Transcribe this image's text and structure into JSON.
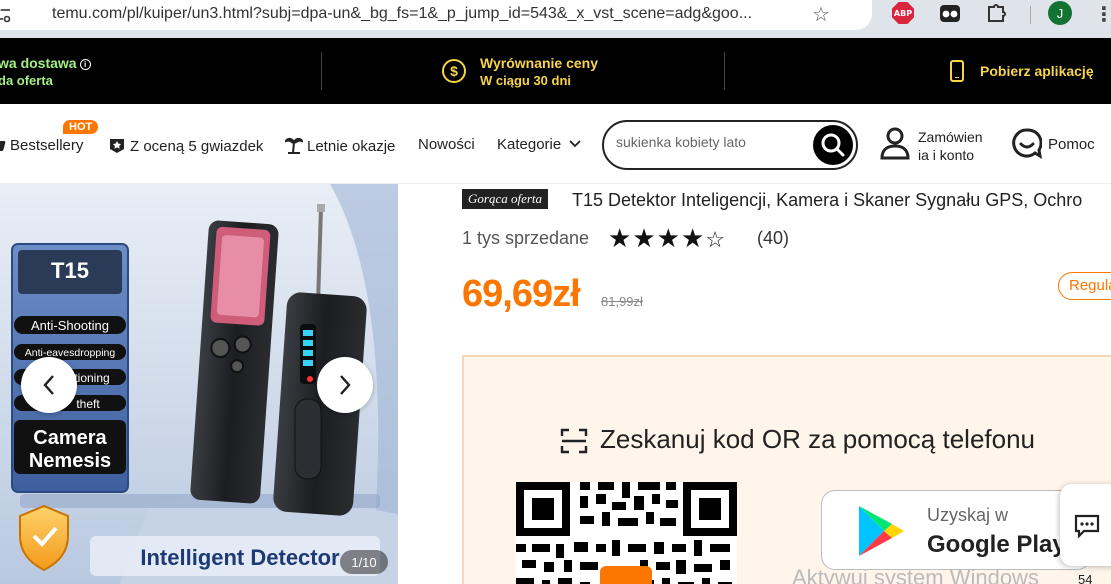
{
  "browser": {
    "url": "temu.com/pl/kuiper/un3.html?subj=dpa-un&_bg_fs=1&_p_jump_id=543&_x_vst_scene=adg&goo...",
    "abp_label": "ABP",
    "profile_initial": "J"
  },
  "promo": {
    "delivery_title": "wa dostawa",
    "delivery_sub": "da oferta",
    "price_title": "Wyrównanie ceny",
    "price_sub": "W ciągu 30 dni",
    "app_label": "Pobierz aplikację"
  },
  "nav": {
    "bestsellers": "Bestsellery",
    "hot_badge": "HOT",
    "five_stars": "Z oceną 5 gwiazdek",
    "summer": "Letnie okazje",
    "new": "Nowości",
    "categories": "Kategorie",
    "search_placeholder": "sukienka kobiety lato",
    "account_line1": "Zamówien",
    "account_line2": "ia i konto",
    "help": "Pomoc"
  },
  "gallery": {
    "counter": "1/10",
    "image_text": {
      "model": "T15",
      "feature1": "Anti-Shooting",
      "feature2": "Anti-eavesdropping",
      "feature3": "tioning",
      "feature4": "theft",
      "camera": "Camera",
      "nemesis": "Nemesis",
      "tagline": "Intelligent Detector"
    }
  },
  "product": {
    "badge": "Gorąca oferta",
    "title": "T15 Detektor Inteligencji, Kamera i Skaner Sygnału GPS, Ochro",
    "sold": "1 tys sprzedane",
    "rating": 4,
    "rating_max": 5,
    "reviews": "(40)",
    "price": "69,69zł",
    "old_price": "81,99zł",
    "regular_label": "Regula"
  },
  "app_panel": {
    "scan_text": "Zeskanuj kod OR za pomocą telefonu",
    "play_line1": "Uzyskaj w",
    "play_line2": "Google Play",
    "watermark": "Aktywuj system Windows",
    "side_number": "54"
  },
  "colors": {
    "accent": "#fb7701",
    "promo_green": "#a3ee85",
    "promo_yellow": "#f7d44a"
  }
}
